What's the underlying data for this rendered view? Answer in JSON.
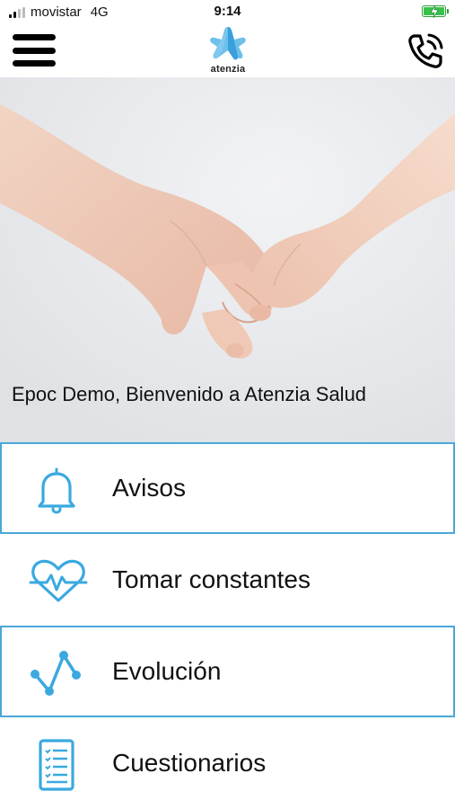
{
  "status_bar": {
    "carrier": "movistar",
    "network": "4G",
    "time": "9:14"
  },
  "header": {
    "logo_text": "atenzia",
    "menu_icon": "hamburger-menu-icon",
    "call_icon": "phone-call-icon"
  },
  "hero": {
    "welcome_text": "Epoc Demo, Bienvenido a Atenzia Salud"
  },
  "menu": {
    "items": [
      {
        "label": "Avisos",
        "icon": "bell-icon",
        "highlighted": true
      },
      {
        "label": "Tomar constantes",
        "icon": "heart-pulse-icon",
        "highlighted": false
      },
      {
        "label": "Evolución",
        "icon": "line-chart-icon",
        "highlighted": true
      },
      {
        "label": "Cuestionarios",
        "icon": "checklist-icon",
        "highlighted": false
      }
    ]
  },
  "colors": {
    "accent": "#4aa8d8",
    "icon_blue": "#3aa9e0",
    "battery_green": "#39c04a"
  }
}
